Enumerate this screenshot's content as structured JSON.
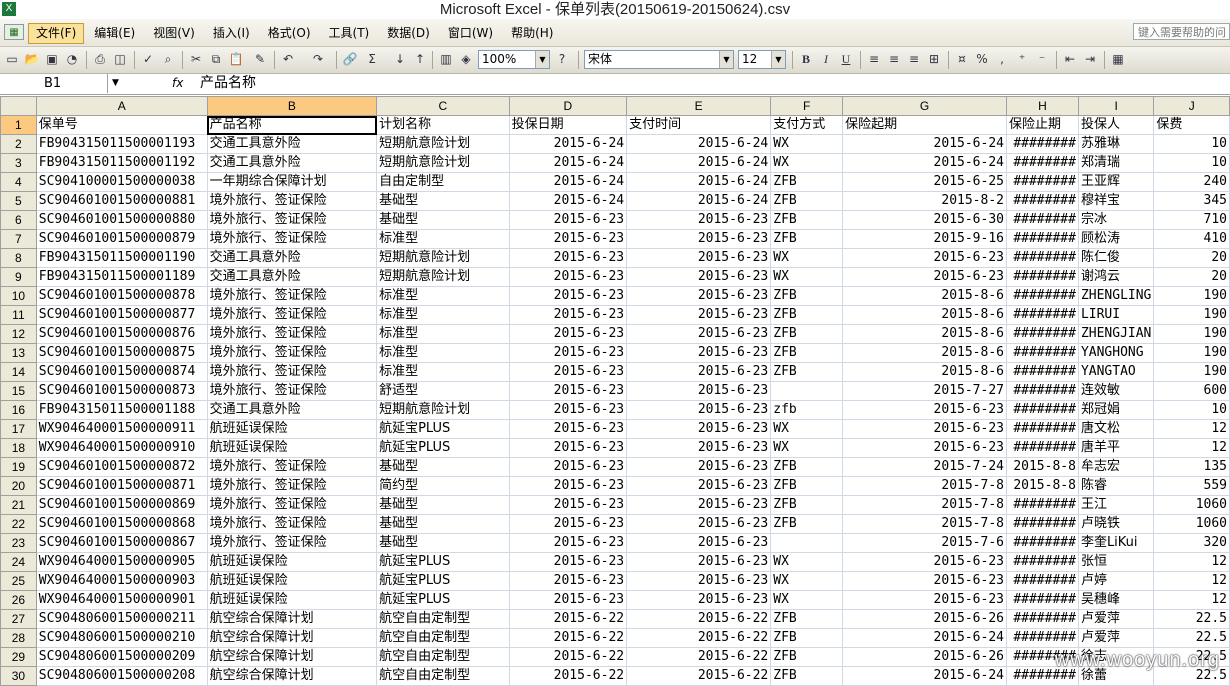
{
  "window": {
    "title": "Microsoft Excel - 保单列表(20150619-20150624).csv"
  },
  "menu": {
    "items": [
      "文件(F)",
      "编辑(E)",
      "视图(V)",
      "插入(I)",
      "格式(O)",
      "工具(T)",
      "数据(D)",
      "窗口(W)",
      "帮助(H)"
    ],
    "active_index": 0,
    "help_placeholder": "键入需要帮助的问"
  },
  "toolbar": {
    "zoom": "100%",
    "font": "宋体",
    "size": "12"
  },
  "formula_bar": {
    "cell_ref": "B1",
    "fx": "fx",
    "value": "产品名称"
  },
  "sheet": {
    "columns": [
      "A",
      "B",
      "C",
      "D",
      "E",
      "F",
      "G",
      "H",
      "I",
      "J"
    ],
    "selected_col": "B",
    "selected_row": 1,
    "rows": [
      [
        "1",
        "保单号",
        "产品名称",
        "计划名称",
        "投保日期",
        "支付时间",
        "支付方式",
        "保险起期",
        "保险止期",
        "投保人",
        "保费"
      ],
      [
        "2",
        "FB904315011500001193",
        "交通工具意外险",
        "短期航意险计划",
        "2015-6-24",
        "2015-6-24",
        "WX",
        "2015-6-24",
        "########",
        "苏雅琳",
        "10"
      ],
      [
        "3",
        "FB904315011500001192",
        "交通工具意外险",
        "短期航意险计划",
        "2015-6-24",
        "2015-6-24",
        "WX",
        "2015-6-24",
        "########",
        "郑清瑞",
        "10"
      ],
      [
        "4",
        "SC904100001500000038",
        "一年期综合保障计划",
        "自由定制型",
        "2015-6-24",
        "2015-6-24",
        "ZFB",
        "2015-6-25",
        "########",
        "王亚辉",
        "240"
      ],
      [
        "5",
        "SC904601001500000881",
        "境外旅行、签证保险",
        "基础型",
        "2015-6-24",
        "2015-6-24",
        "ZFB",
        "2015-8-2",
        "########",
        "穆祥宝",
        "345"
      ],
      [
        "6",
        "SC904601001500000880",
        "境外旅行、签证保险",
        "基础型",
        "2015-6-23",
        "2015-6-23",
        "ZFB",
        "2015-6-30",
        "########",
        "宗冰",
        "710"
      ],
      [
        "7",
        "SC904601001500000879",
        "境外旅行、签证保险",
        "标准型",
        "2015-6-23",
        "2015-6-23",
        "ZFB",
        "2015-9-16",
        "########",
        "顾松涛",
        "410"
      ],
      [
        "8",
        "FB904315011500001190",
        "交通工具意外险",
        "短期航意险计划",
        "2015-6-23",
        "2015-6-23",
        "WX",
        "2015-6-23",
        "########",
        "陈仁俊",
        "20"
      ],
      [
        "9",
        "FB904315011500001189",
        "交通工具意外险",
        "短期航意险计划",
        "2015-6-23",
        "2015-6-23",
        "WX",
        "2015-6-23",
        "########",
        "谢鸿云",
        "20"
      ],
      [
        "10",
        "SC904601001500000878",
        "境外旅行、签证保险",
        "标准型",
        "2015-6-23",
        "2015-6-23",
        "ZFB",
        "2015-8-6",
        "########",
        "ZHENGLING",
        "190"
      ],
      [
        "11",
        "SC904601001500000877",
        "境外旅行、签证保险",
        "标准型",
        "2015-6-23",
        "2015-6-23",
        "ZFB",
        "2015-8-6",
        "########",
        "LIRUI",
        "190"
      ],
      [
        "12",
        "SC904601001500000876",
        "境外旅行、签证保险",
        "标准型",
        "2015-6-23",
        "2015-6-23",
        "ZFB",
        "2015-8-6",
        "########",
        "ZHENGJIAN",
        "190"
      ],
      [
        "13",
        "SC904601001500000875",
        "境外旅行、签证保险",
        "标准型",
        "2015-6-23",
        "2015-6-23",
        "ZFB",
        "2015-8-6",
        "########",
        "YANGHONG",
        "190"
      ],
      [
        "14",
        "SC904601001500000874",
        "境外旅行、签证保险",
        "标准型",
        "2015-6-23",
        "2015-6-23",
        "ZFB",
        "2015-8-6",
        "########",
        "YANGTAO",
        "190"
      ],
      [
        "15",
        "SC904601001500000873",
        "境外旅行、签证保险",
        "舒适型",
        "2015-6-23",
        "2015-6-23",
        "",
        "2015-7-27",
        "########",
        "连效敏",
        "600"
      ],
      [
        "16",
        "FB904315011500001188",
        "交通工具意外险",
        "短期航意险计划",
        "2015-6-23",
        "2015-6-23",
        "zfb",
        "2015-6-23",
        "########",
        "郑冠娟",
        "10"
      ],
      [
        "17",
        "WX904640001500000911",
        "航班延误保险",
        "航延宝PLUS",
        "2015-6-23",
        "2015-6-23",
        "WX",
        "2015-6-23",
        "########",
        "唐文松",
        "12"
      ],
      [
        "18",
        "WX904640001500000910",
        "航班延误保险",
        "航延宝PLUS",
        "2015-6-23",
        "2015-6-23",
        "WX",
        "2015-6-23",
        "########",
        "唐羊平",
        "12"
      ],
      [
        "19",
        "SC904601001500000872",
        "境外旅行、签证保险",
        "基础型",
        "2015-6-23",
        "2015-6-23",
        "ZFB",
        "2015-7-24",
        "2015-8-8",
        "牟志宏",
        "135"
      ],
      [
        "20",
        "SC904601001500000871",
        "境外旅行、签证保险",
        "简约型",
        "2015-6-23",
        "2015-6-23",
        "ZFB",
        "2015-7-8",
        "2015-8-8",
        "陈睿",
        "559"
      ],
      [
        "21",
        "SC904601001500000869",
        "境外旅行、签证保险",
        "基础型",
        "2015-6-23",
        "2015-6-23",
        "ZFB",
        "2015-7-8",
        "########",
        "王江",
        "1060"
      ],
      [
        "22",
        "SC904601001500000868",
        "境外旅行、签证保险",
        "基础型",
        "2015-6-23",
        "2015-6-23",
        "ZFB",
        "2015-7-8",
        "########",
        "卢晓铁",
        "1060"
      ],
      [
        "23",
        "SC904601001500000867",
        "境外旅行、签证保险",
        "基础型",
        "2015-6-23",
        "2015-6-23",
        "",
        "2015-7-6",
        "########",
        "李奎LiKui",
        "320"
      ],
      [
        "24",
        "WX904640001500000905",
        "航班延误保险",
        "航延宝PLUS",
        "2015-6-23",
        "2015-6-23",
        "WX",
        "2015-6-23",
        "########",
        "张恒",
        "12"
      ],
      [
        "25",
        "WX904640001500000903",
        "航班延误保险",
        "航延宝PLUS",
        "2015-6-23",
        "2015-6-23",
        "WX",
        "2015-6-23",
        "########",
        "卢婷",
        "12"
      ],
      [
        "26",
        "WX904640001500000901",
        "航班延误保险",
        "航延宝PLUS",
        "2015-6-23",
        "2015-6-23",
        "WX",
        "2015-6-23",
        "########",
        "吴穗峰",
        "12"
      ],
      [
        "27",
        "SC904806001500000211",
        "航空综合保障计划",
        "航空自由定制型",
        "2015-6-22",
        "2015-6-22",
        "ZFB",
        "2015-6-26",
        "########",
        "卢爱萍",
        "22.5"
      ],
      [
        "28",
        "SC904806001500000210",
        "航空综合保障计划",
        "航空自由定制型",
        "2015-6-22",
        "2015-6-22",
        "ZFB",
        "2015-6-24",
        "########",
        "卢爱萍",
        "22.5"
      ],
      [
        "29",
        "SC904806001500000209",
        "航空综合保障计划",
        "航空自由定制型",
        "2015-6-22",
        "2015-6-22",
        "ZFB",
        "2015-6-26",
        "########",
        "徐志",
        "22.5"
      ],
      [
        "30",
        "SC904806001500000208",
        "航空综合保障计划",
        "航空自由定制型",
        "2015-6-22",
        "2015-6-22",
        "ZFB",
        "2015-6-24",
        "########",
        "徐蕾",
        "22.5"
      ]
    ]
  },
  "watermark": "www.wooyun.org"
}
